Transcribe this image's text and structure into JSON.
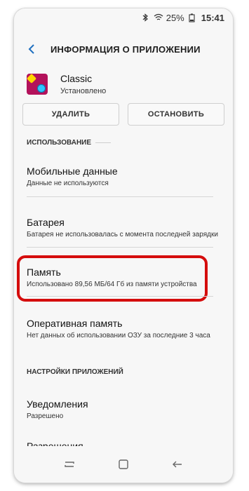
{
  "status_bar": {
    "battery_percent": "25%",
    "time": "15:41",
    "icons": [
      "bluetooth-icon",
      "wifi-icon",
      "battery-icon"
    ]
  },
  "app_bar": {
    "title": "ИНФОРМАЦИЯ О ПРИЛОЖЕНИИ",
    "back_icon": "back-arrow-icon"
  },
  "app": {
    "name": "Classic",
    "status": "Установлено",
    "icon": "app-icon"
  },
  "buttons": {
    "delete_label": "УДАЛИТЬ",
    "stop_label": "ОСТАНОВИТЬ"
  },
  "sections": {
    "usage": "ИСПОЛЬЗОВАНИЕ",
    "app_settings": "НАСТРОЙКИ ПРИЛОЖЕНИЙ"
  },
  "usage_items": [
    {
      "title": "Мобильные данные",
      "subtitle": "Данные не используются"
    },
    {
      "title": "Батарея",
      "subtitle": "Батарея не использовалась с момента последней зарядки"
    },
    {
      "title": "Память",
      "subtitle": "Использовано 89,56 МБ/64 Гб из памяти устройства"
    },
    {
      "title": "Оперативная память",
      "subtitle": "Нет данных об использовании ОЗУ за последние 3 часа"
    }
  ],
  "settings_items": [
    {
      "title": "Уведомления",
      "subtitle": "Разрешено"
    },
    {
      "title": "Разрешения",
      "subtitle": ""
    }
  ],
  "highlight_color": "#d50d0d",
  "nav_bar": {
    "icons": [
      "recent-apps-icon",
      "home-icon",
      "back-icon"
    ]
  }
}
